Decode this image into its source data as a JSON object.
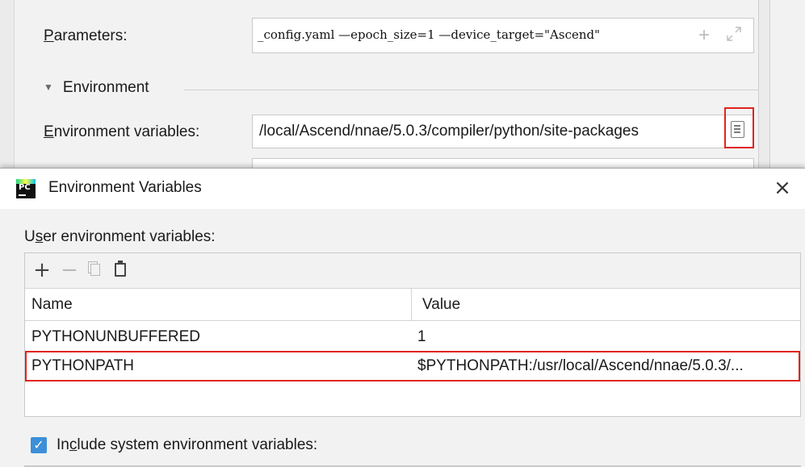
{
  "run_config": {
    "parameters_label_prefix": "P",
    "parameters_label_rest": "arameters:",
    "parameters_value": "_config.yaml —epoch_size=1 —device_target=\"Ascend\"",
    "environment_section_label": "Environment",
    "env_vars_label_prefix": "E",
    "env_vars_label_rest": "nvironment variables:",
    "env_vars_value": "/local/Ascend/nnae/5.0.3/compiler/python/site-packages"
  },
  "dialog": {
    "title": "Environment Variables",
    "logo_text": "PC",
    "close_glyph": "×",
    "user_env_label_a": "U",
    "user_env_label_u": "s",
    "user_env_label_b": "er environment variables:",
    "toolbar": {
      "add": "+",
      "remove": "−"
    },
    "table": {
      "columns": [
        "Name",
        "Value"
      ],
      "rows": [
        {
          "name": "PYTHONUNBUFFERED",
          "value": "1"
        },
        {
          "name": "PYTHONPATH",
          "value": "$PYTHONPATH:/usr/local/Ascend/nnae/5.0.3/..."
        }
      ]
    },
    "include_label_a": "In",
    "include_label_u": "c",
    "include_label_b": "lude system environment variables:",
    "include_checked": true
  },
  "colors": {
    "highlight": "#e0241f",
    "checkbox": "#3c8fd8"
  }
}
